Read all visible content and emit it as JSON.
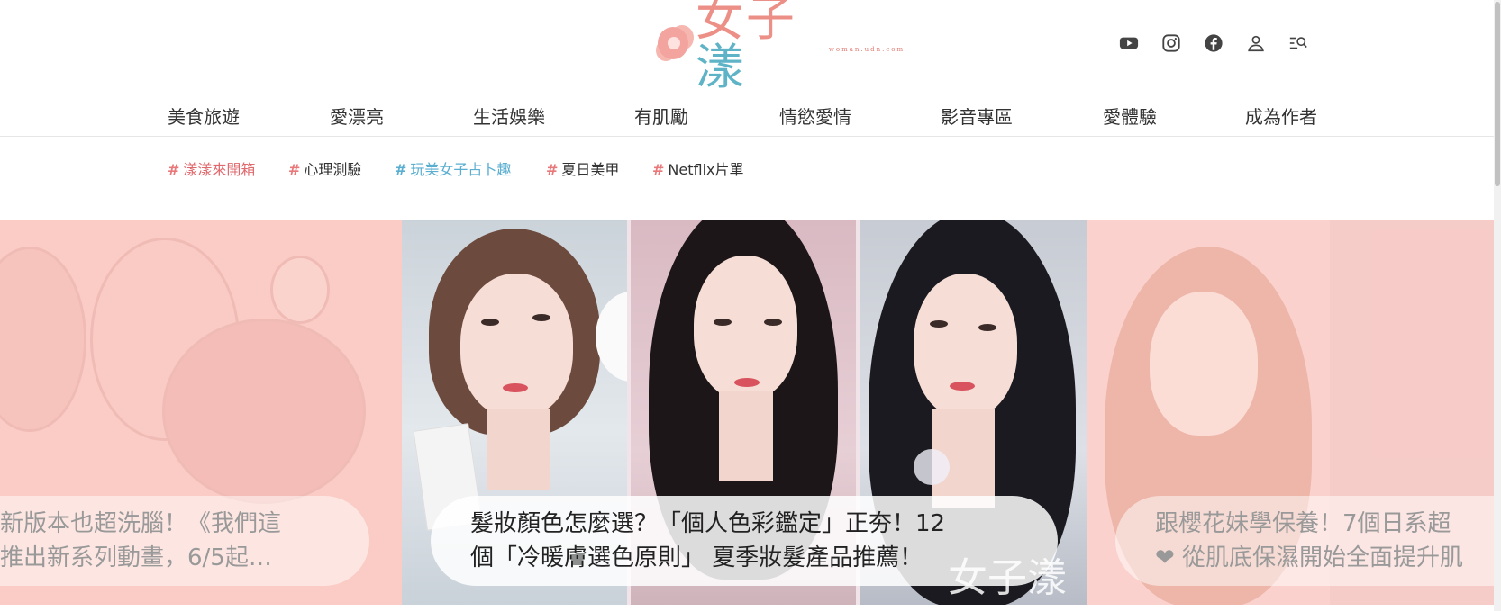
{
  "logo": {
    "text_main": "女子",
    "text_accent": "漾",
    "sub": "woman.udn.com"
  },
  "header_icons": [
    "youtube-icon",
    "instagram-icon",
    "facebook-icon",
    "user-icon",
    "search-icon"
  ],
  "nav": {
    "items": [
      {
        "label": "美食旅遊"
      },
      {
        "label": "愛漂亮"
      },
      {
        "label": "生活娛樂"
      },
      {
        "label": "有肌勵"
      },
      {
        "label": "情慾愛情"
      },
      {
        "label": "影音專區"
      },
      {
        "label": "愛體驗"
      },
      {
        "label": "成為作者"
      }
    ]
  },
  "tags": [
    {
      "label": "漾漾來開箱",
      "color": "#e0696d"
    },
    {
      "label": "心理測驗",
      "color": "#333333"
    },
    {
      "label": "玩美女子占卜趣",
      "color": "#5aaed0"
    },
    {
      "label": "夏日美甲",
      "color": "#333333"
    },
    {
      "label": "Netflix片單",
      "color": "#333333"
    }
  ],
  "hash_symbol": "#",
  "carousel": {
    "left_caption": {
      "line1": "新版本也超洗腦！《我們這",
      "line2": "推出新系列動畫，6/5起…"
    },
    "center_caption": {
      "line1": "髮妝顏色怎麼選？「個人色彩鑑定」正夯！12",
      "line2": "個「冷暖膚選色原則」 夏季妝髮產品推薦！"
    },
    "right_caption": {
      "line1": "跟櫻花妹學保養！7個日系超",
      "line2": "❤ 從肌底保濕開始全面提升肌"
    },
    "watermark": "女子漾"
  }
}
